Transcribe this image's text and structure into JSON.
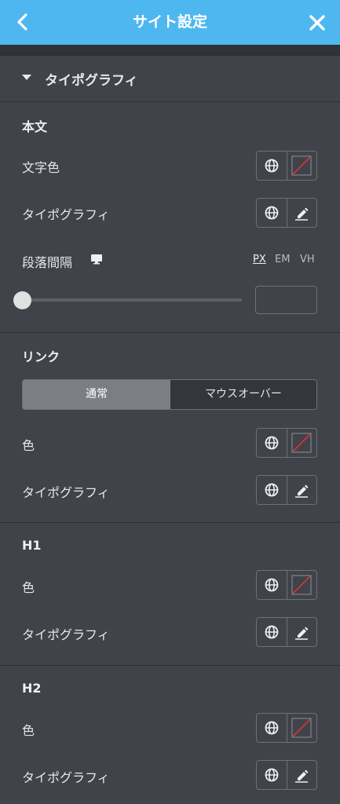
{
  "header": {
    "title": "サイト設定"
  },
  "accordion": {
    "label": "タイポグラフィ"
  },
  "body_section": {
    "heading": "本文",
    "text_color_label": "文字色",
    "typography_label": "タイポグラフィ",
    "paragraph_spacing_label": "段落間隔",
    "units": [
      "PX",
      "EM",
      "VH"
    ],
    "active_unit": "PX",
    "spacing_value": ""
  },
  "link_section": {
    "heading": "リンク",
    "tabs": {
      "normal": "通常",
      "hover": "マウスオーバー"
    },
    "color_label": "色",
    "typography_label": "タイポグラフィ"
  },
  "h1_section": {
    "heading": "H1",
    "color_label": "色",
    "typography_label": "タイポグラフィ"
  },
  "h2_section": {
    "heading": "H2",
    "color_label": "色",
    "typography_label": "タイポグラフィ"
  },
  "icons": {
    "global": "globe-icon",
    "no_color": "no-color-swatch-icon",
    "edit": "pencil-icon",
    "device": "desktop-icon"
  },
  "colors": {
    "header_bg": "#4fb7ef",
    "panel_bg": "#404349",
    "swatch_slash": "#d8343b"
  }
}
